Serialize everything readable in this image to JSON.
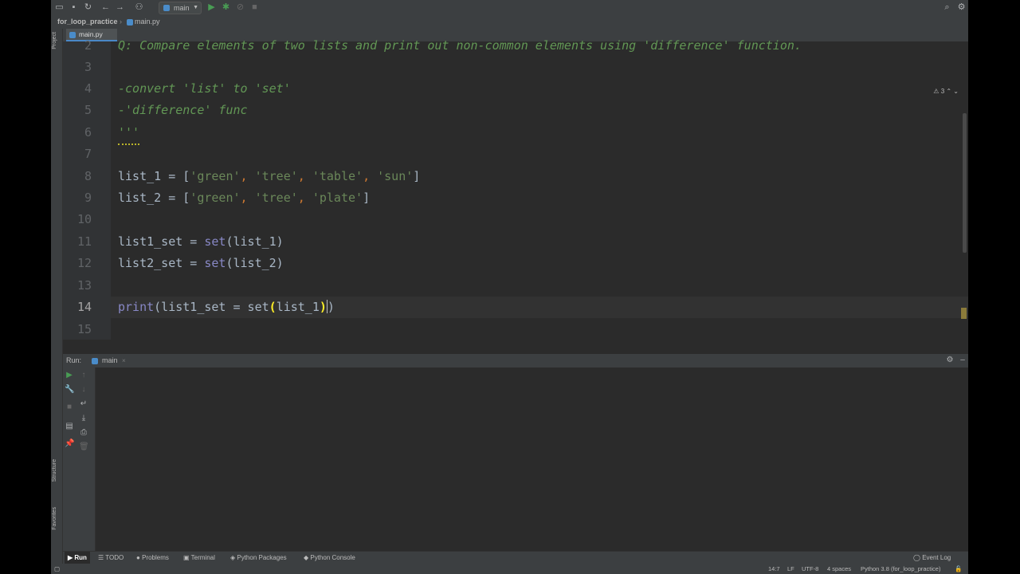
{
  "toolbar": {
    "run_config": "main",
    "icons": [
      "open-folder-icon",
      "save-icon",
      "sync-icon",
      "back-icon",
      "forward-icon",
      "vcs-icon",
      "run-icon",
      "debug-icon",
      "coverage-icon",
      "stop-icon",
      "search-icon",
      "settings-icon"
    ]
  },
  "breadcrumb": {
    "project": "for_loop_practice",
    "file": "main.py"
  },
  "sidebar": {
    "project": "Project",
    "structure": "Structure",
    "favorites": "Favorites"
  },
  "editor": {
    "tab": "main.py",
    "inspection_count": "3",
    "lines": [
      {
        "num": "2",
        "text": "Q: Compare elements of two lists and print out non-common elements using 'difference' function."
      },
      {
        "num": "3",
        "text": ""
      },
      {
        "num": "4",
        "text": "-convert 'list' to 'set'"
      },
      {
        "num": "5",
        "text": "-'difference' func"
      },
      {
        "num": "6",
        "text": "'''"
      },
      {
        "num": "7",
        "text": ""
      },
      {
        "num": "8",
        "text": "list_1 = ['green', 'tree', 'table', 'sun']"
      },
      {
        "num": "9",
        "text": "list_2 = ['green', 'tree', 'plate']"
      },
      {
        "num": "10",
        "text": ""
      },
      {
        "num": "11",
        "text": "list1_set = set(list_1)"
      },
      {
        "num": "12",
        "text": "list2_set = set(list_2)"
      },
      {
        "num": "13",
        "text": ""
      },
      {
        "num": "14",
        "text": "print(list1_set = set(list_1))"
      },
      {
        "num": "15",
        "text": ""
      }
    ],
    "tokens": {
      "l2": "Q: Compare elements of two lists and print out non-common elements using 'difference' function.",
      "l4": "-convert 'list' to 'set'",
      "l5": "-'difference' func",
      "l6": "'''",
      "l8_a": "list_1 = [",
      "l8_s1": "'green'",
      "l8_c": ", ",
      "l8_s2": "'tree'",
      "l8_s3": "'table'",
      "l8_s4": "'sun'",
      "l8_z": "]",
      "l9_a": "list_2 = [",
      "l9_s1": "'green'",
      "l9_s2": "'tree'",
      "l9_s3": "'plate'",
      "l9_z": "]",
      "l11_a": "list1_set = ",
      "l11_b": "set",
      "l11_c": "(list_1)",
      "l12_a": "list2_set = ",
      "l12_b": "set",
      "l12_c": "(list_2)",
      "l14_a": "print",
      "l14_b": "(list1_set = set",
      "l14_p1": "(",
      "l14_c": "list_1",
      "l14_p2": ")",
      "l14_z": ")"
    }
  },
  "run_panel": {
    "label": "Run:",
    "tab": "main",
    "console_output": ""
  },
  "bottom_tabs": [
    "Run",
    "TODO",
    "Problems",
    "Terminal",
    "Python Packages",
    "Python Console"
  ],
  "event_log": "Event Log",
  "status": {
    "position": "14:7",
    "line_sep": "LF",
    "encoding": "UTF-8",
    "indent": "4 spaces",
    "interpreter": "Python 3.8 (for_loop_practice)"
  },
  "colors": {
    "background": "#2b2b2b",
    "panel": "#3c3f41",
    "docstring": "#629755",
    "string": "#6a8759",
    "builtin": "#8888c6",
    "brace_match": "#ffef28"
  }
}
